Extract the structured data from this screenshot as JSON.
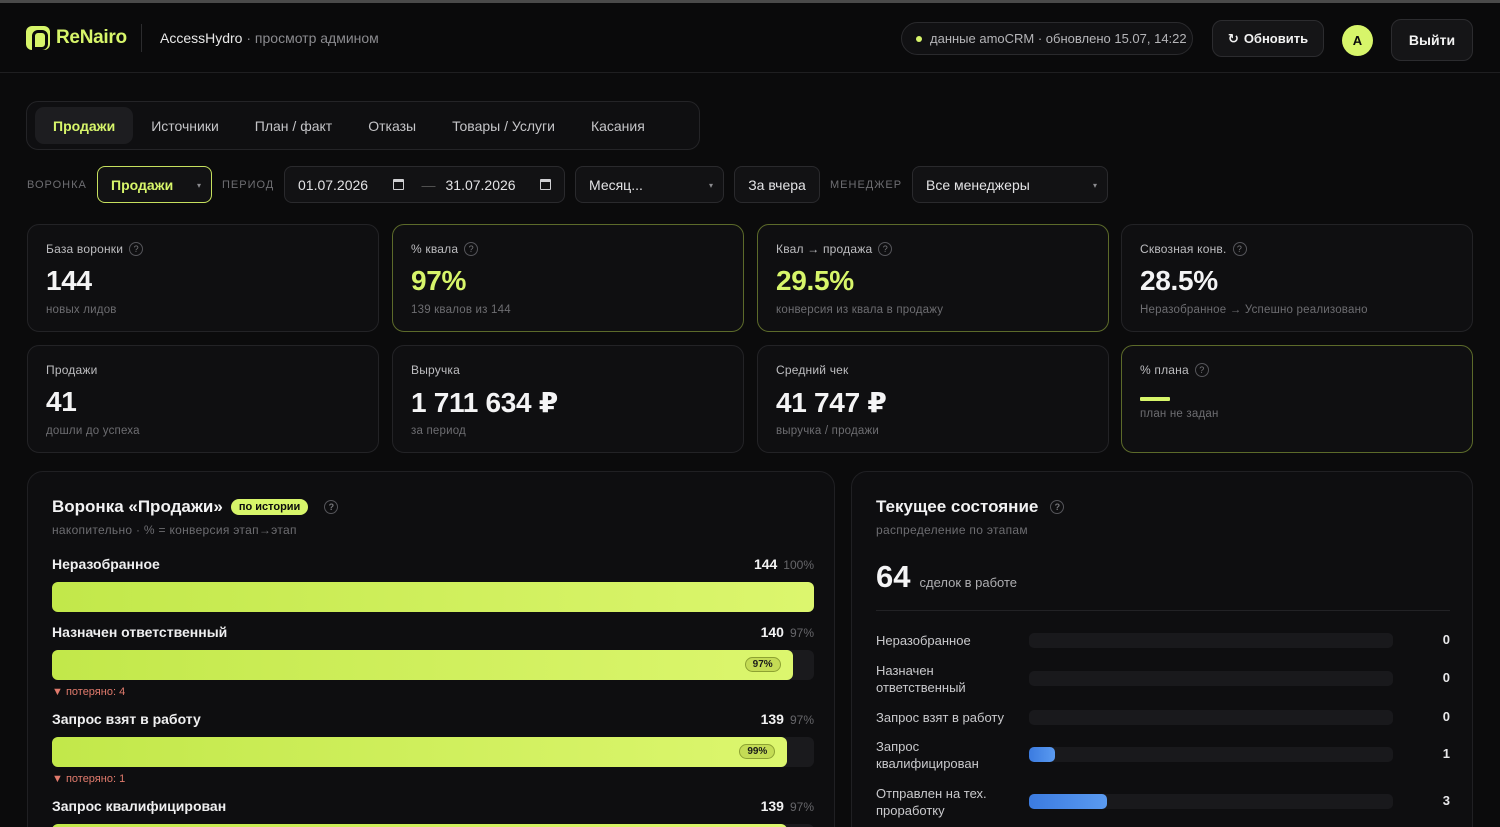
{
  "colors": {
    "accent": "#d7f56a",
    "bg": "#0b0b0c",
    "blue": "#4a8ae8",
    "lost": "#e07a6c"
  },
  "header": {
    "brand": "ReNairo",
    "tenant": "AccessHydro",
    "tenant_sub": "· просмотр админом",
    "status": "данные amoCRM · обновлено 15.07, 14:22",
    "refresh_label": "Обновить",
    "avatar_initial": "A",
    "logout_label": "Выйти"
  },
  "tabs": [
    "Продажи",
    "Источники",
    "План / факт",
    "Отказы",
    "Товары / Услуги",
    "Касания"
  ],
  "filters": {
    "funnel_label": "ВОРОНКА",
    "funnel_value": "Продажи",
    "period_label": "ПЕРИОД",
    "date_from": "01.07.2026",
    "date_to": "31.07.2026",
    "period_preset": "Месяц...",
    "yesterday_label": "За вчера",
    "manager_label": "МЕНЕДЖЕР",
    "manager_value": "Все менеджеры"
  },
  "kpis": [
    {
      "label": "База воронки",
      "value": "144",
      "note": "новых лидов"
    },
    {
      "label": "% квала",
      "value": "97%",
      "note": "139 квалов из 144"
    },
    {
      "label": "Квал → продажа",
      "value": "29.5%",
      "note": "конверсия из квала в продажу"
    },
    {
      "label": "Сквозная конв.",
      "value": "28.5%",
      "note": "Неразобранное → Успешно реализовано"
    },
    {
      "label": "Продажи",
      "value": "41",
      "note": "дошли до успеха"
    },
    {
      "label": "Выручка",
      "value": "1 711 634 ₽",
      "note": "за период"
    },
    {
      "label": "Средний чек",
      "value": "41 747 ₽",
      "note": "выручка / продажи"
    },
    {
      "label": "% плана",
      "value": "—",
      "note": "план не задан"
    }
  ],
  "funnel": {
    "title": "Воронка «Продажи»",
    "badge": "по истории",
    "subtitle": "накопительно · % = конверсия этап→этап",
    "stages": [
      {
        "name": "Неразобранное",
        "count": "144",
        "pct": "100%",
        "fill": 1.0,
        "tag": "",
        "lost": ""
      },
      {
        "name": "Назначен ответственный",
        "count": "140",
        "pct": "97%",
        "fill": 0.972,
        "tag": "97%",
        "lost": "▼ потеряно: 4"
      },
      {
        "name": "Запрос взят в работу",
        "count": "139",
        "pct": "97%",
        "fill": 0.965,
        "tag": "99%",
        "lost": "▼ потеряно: 1"
      },
      {
        "name": "Запрос квалифицирован",
        "count": "139",
        "pct": "97%",
        "fill": 0.965,
        "tag": "",
        "lost": ""
      }
    ]
  },
  "state": {
    "title": "Текущее состояние",
    "subtitle": "распределение по этапам",
    "total": "64",
    "total_label": "сделок в работе",
    "rows": [
      {
        "name": "Неразобранное",
        "count": "0",
        "fill": 0
      },
      {
        "name": "Назначен ответственный",
        "count": "0",
        "fill": 0
      },
      {
        "name": "Запрос взят в работу",
        "count": "0",
        "fill": 0
      },
      {
        "name": "Запрос квалифицирован",
        "count": "1",
        "fill": 0.072
      },
      {
        "name": "Отправлен на тех. проработку",
        "count": "3",
        "fill": 0.215
      }
    ]
  }
}
